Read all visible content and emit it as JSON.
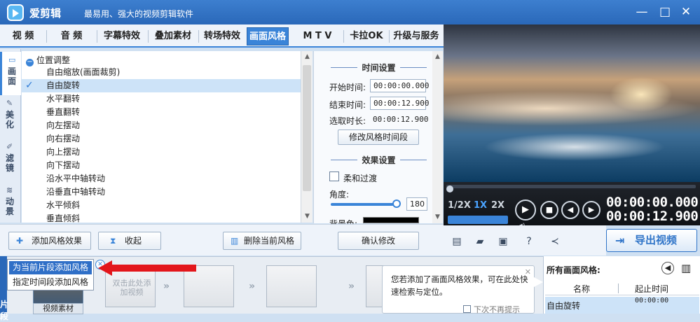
{
  "titlebar": {
    "app_name": "爱剪辑",
    "slogan": "最易用、强大的视频剪辑软件",
    "minimize": "—",
    "maximize": "□",
    "close": "✕"
  },
  "tabs": [
    {
      "label": "视 频"
    },
    {
      "label": "音 频"
    },
    {
      "label": "字幕特效"
    },
    {
      "label": "叠加素材"
    },
    {
      "label": "转场特效"
    },
    {
      "label": "画面风格",
      "active": true
    },
    {
      "label": "M T V"
    },
    {
      "label": "卡拉OK"
    },
    {
      "label": "升级与服务"
    }
  ],
  "sidebar": [
    {
      "icon": "picture-icon",
      "glyph": "▭",
      "label": "画面",
      "active": true
    },
    {
      "icon": "magic-wand-icon",
      "glyph": "✎",
      "label": "美化"
    },
    {
      "icon": "filter-wand-icon",
      "glyph": "✐",
      "label": "滤镜"
    },
    {
      "icon": "wave-icon",
      "glyph": "≋",
      "label": "动景"
    }
  ],
  "effect_list": {
    "group": "位置调整",
    "group_toggle": "−",
    "items": [
      "自由缩放(画面裁剪)",
      "自由旋转",
      "水平翻转",
      "垂直翻转",
      "向左摆动",
      "向右摆动",
      "向上摆动",
      "向下摆动",
      "沿水平中轴转动",
      "沿垂直中轴转动",
      "水平倾斜",
      "垂直倾斜"
    ],
    "selected_index": 1,
    "selected_mark": "✓"
  },
  "time_settings": {
    "title": "时间设置",
    "start_label": "开始时间:",
    "start_value": "00:00:00.000",
    "end_label": "结束时间:",
    "end_value": "00:00:12.900",
    "duration_label": "选取时长:",
    "duration_value": "00:00:12.900",
    "edit_button": "修改风格时间段"
  },
  "effect_settings": {
    "title": "效果设置",
    "smooth_label": "柔和过渡",
    "angle_label": "角度:",
    "angle_value": "180",
    "bg_label": "背景色:"
  },
  "player": {
    "speeds": [
      "1/2X",
      "1X",
      "2X"
    ],
    "active_speed": "1X",
    "current_time": "00:00:00.000",
    "total_time": "00:00:12.900",
    "progress": 0.0
  },
  "actions": {
    "add_effect": "添加风格效果",
    "collapse": "收起",
    "delete_effect": "删除当前风格",
    "confirm": "确认修改"
  },
  "export": {
    "label": "导出视频"
  },
  "popup_menu": {
    "items": [
      "为当前片段添加风格",
      "指定时间段添加风格"
    ],
    "highlight_index": 0
  },
  "timeline": {
    "track_label": "片段",
    "clip_label": "视频素材",
    "add_hint": "双击此处添加视频"
  },
  "tip": {
    "text": "您若添加了画面风格效果，可在此处快速检索与定位。",
    "no_show": "下次不再提示"
  },
  "styles_panel": {
    "title": "所有画面风格:",
    "col_name": "名称",
    "col_time": "起止时间",
    "rows": [
      {
        "name": "自由旋转",
        "time": "00:00:00"
      }
    ]
  }
}
